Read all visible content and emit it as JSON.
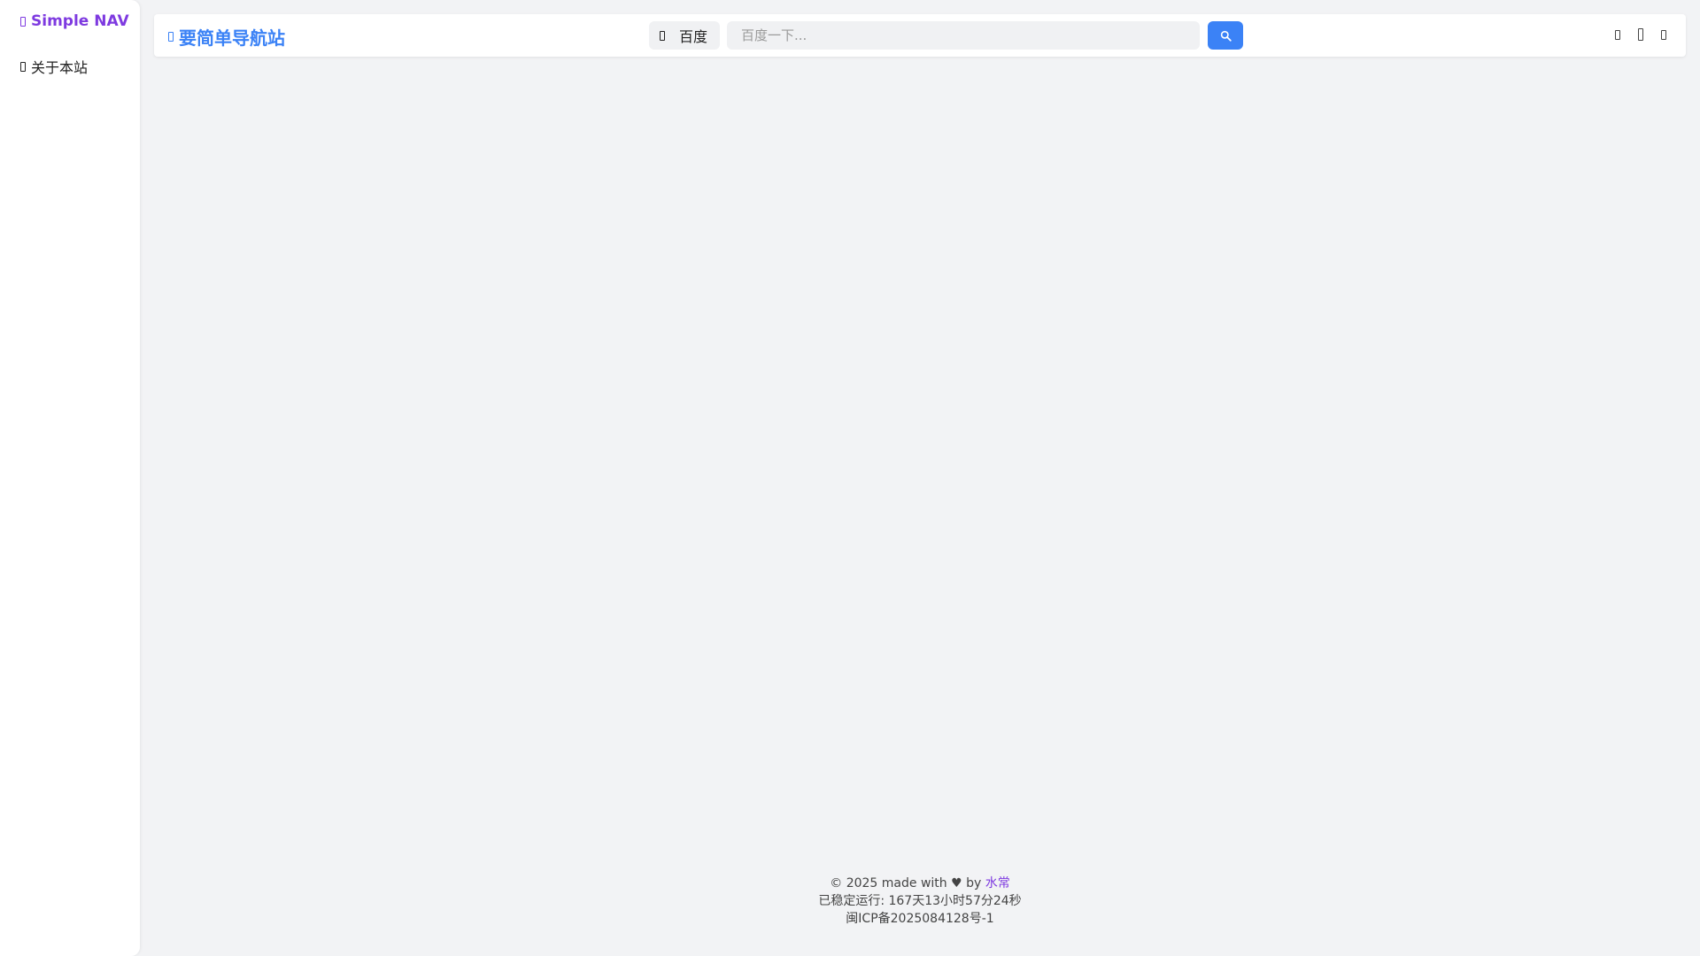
{
  "sidebar": {
    "brand": "Simple NAV",
    "brand_icon": "compass-icon",
    "items": [
      {
        "label": "关于本站",
        "icon": "info-icon"
      }
    ]
  },
  "header": {
    "site_title": "要简单导航站",
    "site_icon": "compass-icon",
    "engine": "百度",
    "engine_icon": "engine-icon",
    "search_placeholder": "百度一下...",
    "search_icon": "search-icon",
    "right_icons": [
      "theme-icon",
      "mobile-icon",
      "settings-icon"
    ]
  },
  "footer": {
    "copyright_prefix": "© 2025 made with ♥ by ",
    "author": "水常",
    "uptime": "已稳定运行: 167天13小时57分24秒",
    "icp": "闽ICP备2025084128号-1"
  },
  "colors": {
    "brand": "#7e3ae0",
    "primary": "#3b82f6",
    "background": "#f2f3f5"
  }
}
